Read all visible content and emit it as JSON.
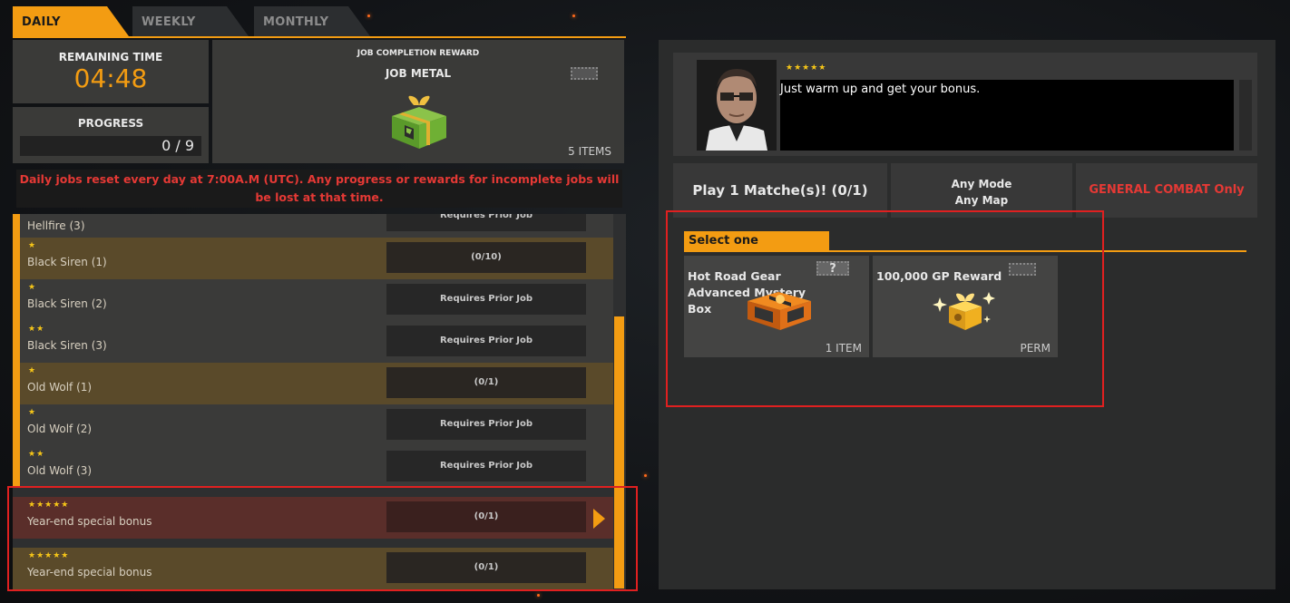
{
  "tabs": [
    {
      "label": "DAILY",
      "active": true
    },
    {
      "label": "WEEKLY",
      "active": false
    },
    {
      "label": "MONTHLY",
      "active": false
    }
  ],
  "remaining": {
    "title": "REMAINING TIME",
    "time": "04:48"
  },
  "progress": {
    "title": "PROGRESS",
    "value": "0 / 9"
  },
  "reward": {
    "title": "JOB COMPLETION REWARD",
    "name": "JOB METAL",
    "count": "5 ITEMS",
    "icon": "gift-box-icon"
  },
  "notice": "Daily jobs reset every day at 7:00A.M (UTC). Any progress or rewards for incomplete jobs will be lost at that time.",
  "jobs": [
    {
      "stars": "",
      "name": "Hellfire (3)",
      "status": "Requires Prior Job"
    },
    {
      "stars": "★",
      "name": "Black Siren (1)",
      "status": "(0/10)"
    },
    {
      "stars": "★",
      "name": "Black Siren (2)",
      "status": "Requires Prior Job"
    },
    {
      "stars": "★★",
      "name": "Black Siren (3)",
      "status": "Requires Prior Job"
    },
    {
      "stars": "★",
      "name": "Old Wolf (1)",
      "status": "(0/1)"
    },
    {
      "stars": "★",
      "name": "Old Wolf (2)",
      "status": "Requires Prior Job"
    },
    {
      "stars": "★★",
      "name": "Old Wolf (3)",
      "status": "Requires Prior Job"
    },
    {
      "stars": "★★★★★",
      "name": "Year-end special bonus",
      "status": "(0/1)"
    },
    {
      "stars": "★★★★★",
      "name": "Year-end special bonus",
      "status": "(0/1)"
    }
  ],
  "detail": {
    "stars": "★★★★★",
    "dialog": "Just warm up and get your bonus.",
    "objective": "Play 1 Matche(s)! (0/1)",
    "mode": "Any Mode",
    "map": "Any Map",
    "restriction": "GENERAL COMBAT Only"
  },
  "select": {
    "label": "Select one",
    "options": [
      {
        "title": "Hot Road Gear Advanced Mystery Box",
        "foot": "1 ITEM",
        "badge": "?",
        "icon": "mystery-box-icon"
      },
      {
        "title": "100,000 GP Reward",
        "foot": "PERM",
        "icon": "gold-gift-icon"
      }
    ]
  },
  "colors": {
    "accent": "#f39c12",
    "warning": "#e53935",
    "highlight": "#e02020"
  }
}
